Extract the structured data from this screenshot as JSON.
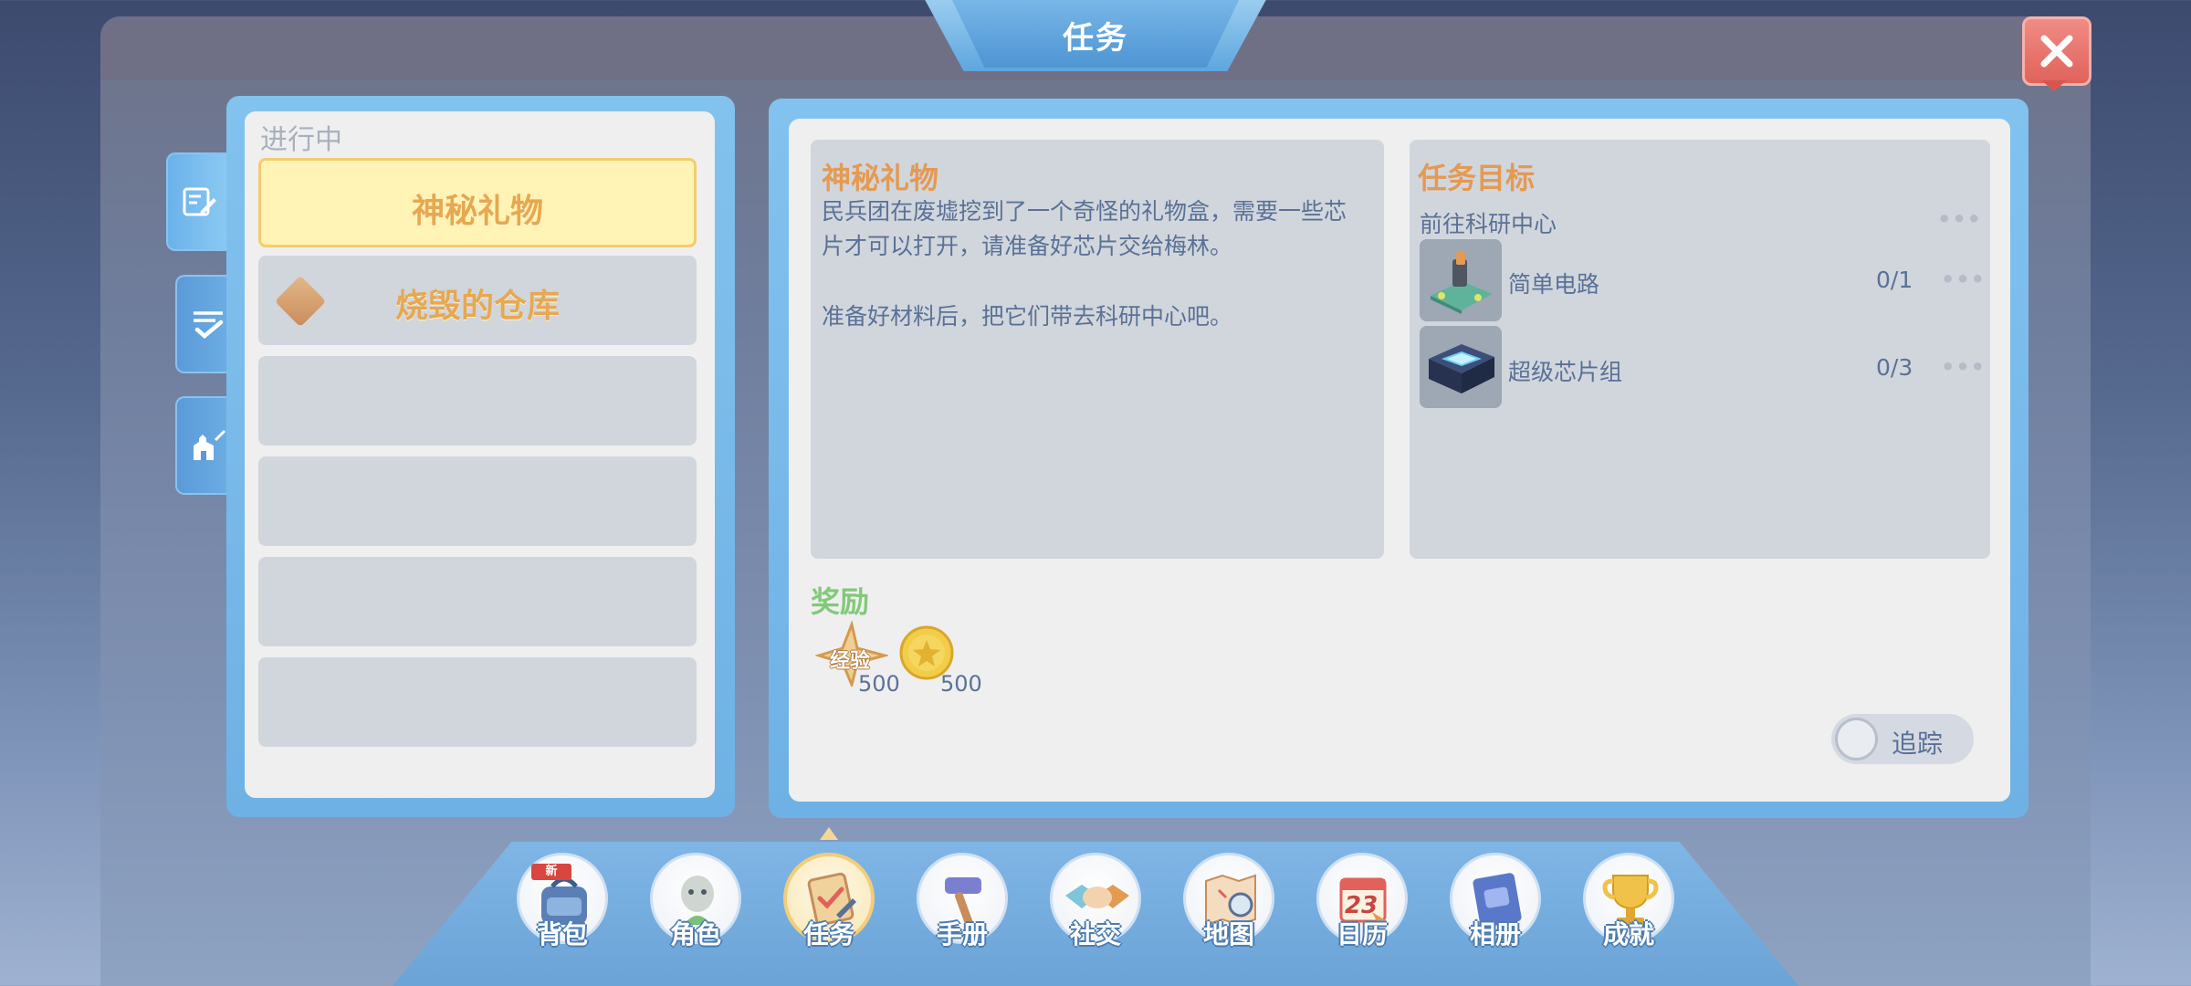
{
  "window": {
    "title": "任务",
    "close_icon": "close-icon"
  },
  "side_tabs": [
    {
      "icon": "pencil-list-icon",
      "active": true
    },
    {
      "icon": "checklist-icon",
      "active": false
    },
    {
      "icon": "castle-icon",
      "active": false
    }
  ],
  "quest_list": {
    "header": "进行中",
    "items": [
      {
        "label": "神秘礼物",
        "selected": true
      },
      {
        "label": "烧毁的仓库",
        "selected": false,
        "icon": "diamond-marker-icon"
      },
      {
        "label": ""
      },
      {
        "label": ""
      },
      {
        "label": ""
      },
      {
        "label": ""
      }
    ]
  },
  "detail": {
    "title": "神秘礼物",
    "description_line1": "民兵团在废墟挖到了一个奇怪的礼物盒，需要一些芯",
    "description_line2": "片才可以打开，请准备好芯片交给梅林。",
    "description_line3": "准备好材料后，把它们带去科研中心吧。"
  },
  "objectives": {
    "title": "任务目标",
    "location": "前往科研中心",
    "location_dots": "•••",
    "items": [
      {
        "name": "简单电路",
        "progress": "0/1",
        "dots": "•••",
        "icon": "circuit-board-icon"
      },
      {
        "name": "超级芯片组",
        "progress": "0/3",
        "dots": "•••",
        "icon": "chip-set-icon"
      }
    ]
  },
  "rewards": {
    "title": "奖励",
    "items": [
      {
        "label": "经验",
        "amount": "500",
        "icon": "exp-star-icon"
      },
      {
        "label": "",
        "amount": "500",
        "icon": "gold-coin-icon"
      }
    ]
  },
  "track": {
    "label": "追踪",
    "on": false
  },
  "bottom_nav": [
    {
      "label": "背包",
      "icon": "backpack-icon",
      "badge": "新"
    },
    {
      "label": "角色",
      "icon": "character-icon"
    },
    {
      "label": "任务",
      "icon": "quest-clipboard-icon",
      "active": true
    },
    {
      "label": "手册",
      "icon": "hammer-icon"
    },
    {
      "label": "社交",
      "icon": "handshake-icon"
    },
    {
      "label": "地图",
      "icon": "map-icon"
    },
    {
      "label": "日历",
      "icon": "calendar-icon",
      "calendar_day": "23"
    },
    {
      "label": "相册",
      "icon": "album-icon"
    },
    {
      "label": "成就",
      "icon": "trophy-icon"
    }
  ],
  "colors": {
    "panel_blue": "#6eb1e4",
    "title_orange": "#e39a52",
    "reward_green": "#82c979",
    "text_blue": "#5a7196",
    "selected_yellow": "#fff3b6",
    "close_red": "#e0625b"
  }
}
